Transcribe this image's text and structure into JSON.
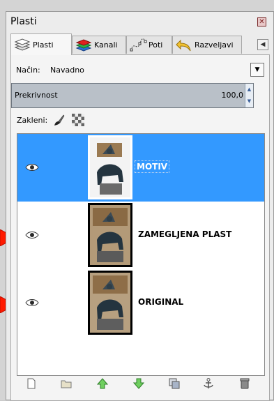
{
  "window": {
    "title": "Plasti"
  },
  "tabs": [
    {
      "label": "Plasti",
      "icon": "layers-icon",
      "active": true
    },
    {
      "label": "Kanali",
      "icon": "channels-icon",
      "active": false
    },
    {
      "label": "Poti",
      "icon": "paths-icon",
      "active": false
    },
    {
      "label": "Razveljavi",
      "icon": "undo-icon",
      "active": false
    }
  ],
  "mode": {
    "label": "Način:",
    "value": "Navadno"
  },
  "opacity": {
    "label": "Prekrivnost",
    "value": "100,0"
  },
  "lock": {
    "label": "Zakleni:"
  },
  "layers": [
    {
      "name": "MOTIV",
      "selected": true,
      "visible": true
    },
    {
      "name": "ZAMEGLJENA PLAST",
      "selected": false,
      "visible": true
    },
    {
      "name": "ORIGINAL",
      "selected": false,
      "visible": true
    }
  ],
  "bottom_actions": [
    "new-layer-icon",
    "open-layer-group-icon",
    "raise-layer-icon",
    "lower-layer-icon",
    "duplicate-layer-icon",
    "anchor-layer-icon",
    "delete-layer-icon"
  ],
  "colors": {
    "selection": "#3399ff",
    "arrow": "#ff1a00",
    "opacity_bg": "#b9c0c8"
  }
}
